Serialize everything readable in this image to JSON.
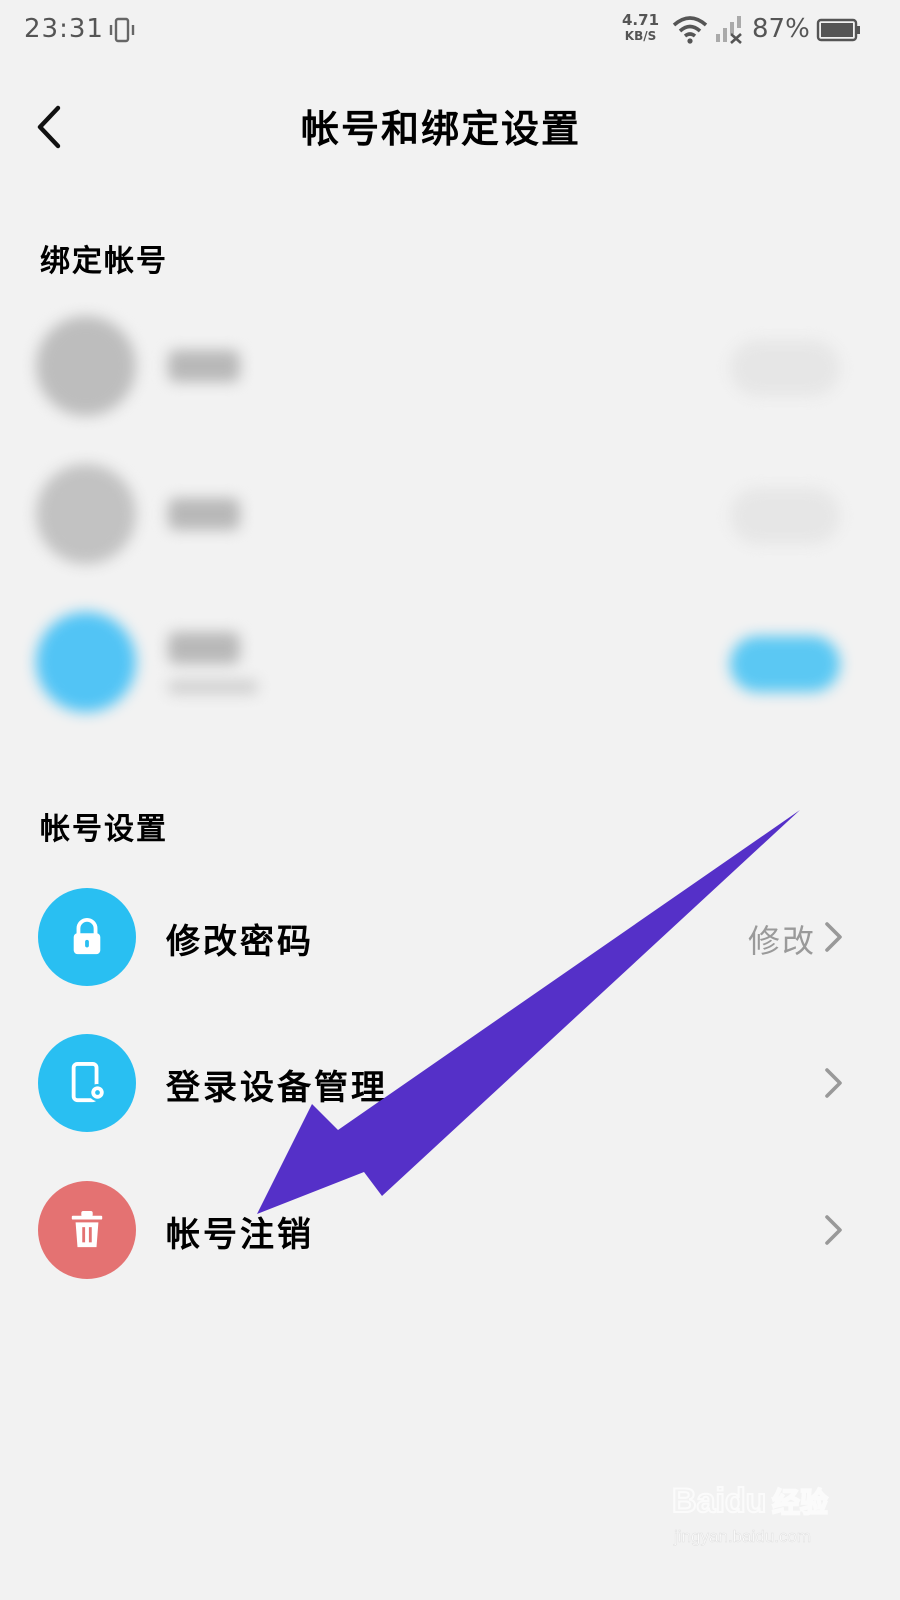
{
  "status_bar": {
    "time": "23:31",
    "net_speed_value": "4.71",
    "net_speed_unit": "KB/S",
    "battery": "87%"
  },
  "header": {
    "title": "帐号和绑定设置"
  },
  "sections": {
    "bound_accounts": "绑定帐号",
    "account_settings": "帐号设置"
  },
  "settings": [
    {
      "label": "修改密码",
      "value": "修改",
      "icon": "lock-icon",
      "color": "#29bff2"
    },
    {
      "label": "登录设备管理",
      "value": "",
      "icon": "device-settings-icon",
      "color": "#29bff2"
    },
    {
      "label": "帐号注销",
      "value": "",
      "icon": "trash-icon",
      "color": "#e47272"
    }
  ],
  "colors": {
    "accent_blue": "#29bff2",
    "danger_red": "#e47272",
    "arrow_purple": "#5530c8",
    "background": "#f2f2f2"
  },
  "watermark": {
    "brand": "Baidu",
    "brand_cn": "经验",
    "url": "jingyan.baidu.com"
  }
}
